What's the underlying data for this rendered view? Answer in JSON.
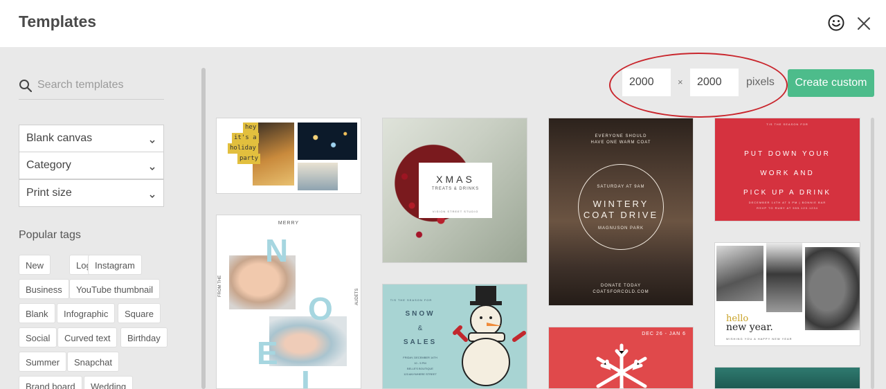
{
  "header": {
    "title": "Templates"
  },
  "sidebar": {
    "search_placeholder": "Search templates",
    "filters": [
      {
        "label": "Blank canvas"
      },
      {
        "label": "Category"
      },
      {
        "label": "Print size"
      }
    ],
    "tags_title": "Popular tags",
    "tags": [
      "New",
      "Logo",
      "Instagram",
      "Business",
      "YouTube thumbnail",
      "Blank",
      "Infographic",
      "Square",
      "Social",
      "Curved text",
      "Birthday",
      "Summer",
      "Snapchat",
      "Brand board",
      "Wedding"
    ]
  },
  "custom": {
    "width": "2000",
    "height": "2000",
    "times": "×",
    "unit": "pixels",
    "create_label": "Create custom"
  },
  "templates": {
    "t1": {
      "lines": [
        "hey",
        "it's a",
        "holiday",
        "party"
      ]
    },
    "t2": {
      "title": "XMAS",
      "sub": "TREATS & DRINKS",
      "foot": "VISION STREET STUDIO"
    },
    "t3": {
      "top1": "EVERYONE SHOULD",
      "top2": "HAVE ONE WARM COAT",
      "small": "SATURDAY AT 9AM",
      "title1": "WINTERY",
      "title2": "COAT DRIVE",
      "place": "MAGNUSON PARK",
      "foot1": "DONATE TODAY",
      "foot2": "COATSFORCOLD.COM"
    },
    "t4": {
      "small": "TIS THE SEASON FOR",
      "line1": "PUT DOWN YOUR",
      "line2": "WORK AND",
      "line3": "PICK UP A DRINK",
      "foot1": "DECEMBER 14TH AT 5 PM | BONNIE BAR",
      "foot2": "RSVP TO RUBY AT 555.123.1234"
    },
    "t5": {
      "top": "MERRY",
      "side1": "FROM THE",
      "side2": "AUDETS",
      "letters": [
        "N",
        "O",
        "E",
        "L"
      ]
    },
    "t6": {
      "small": "TIS THE SEASON FOR",
      "line1": "SNOW",
      "amp": "&",
      "line2": "SALES",
      "foot1": "FRIDAY, DECEMBER 14TH",
      "foot2": "10 - 5 PM",
      "foot3": "BELLE'S BOUTIQUE",
      "foot4": "123 ANYWHERE STREET"
    },
    "t7": {
      "hello": "hello",
      "title": "new year.",
      "foot": "WISHING YOU A HAPPY NEW YEAR"
    },
    "t8": {
      "date": "DEC 26 - JAN 6"
    }
  },
  "colors": {
    "accent": "#4dbc8b",
    "annotation": "#c9262d"
  }
}
